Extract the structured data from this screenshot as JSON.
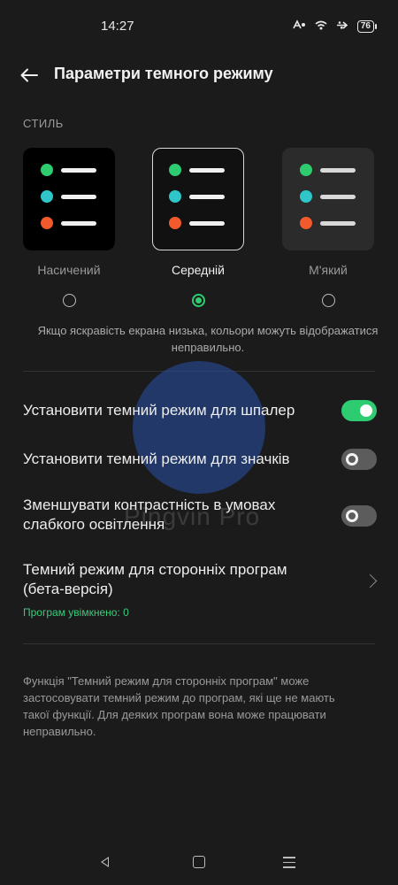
{
  "status_bar": {
    "time": "14:27",
    "battery": "76",
    "icons": [
      "nfc-icon",
      "wifi-icon",
      "usb-icon",
      "battery-icon"
    ]
  },
  "header": {
    "title": "Параметри темного режиму"
  },
  "style_section": {
    "title": "СТИЛЬ",
    "options": [
      {
        "label": "Насичений",
        "selected": false
      },
      {
        "label": "Середній",
        "selected": true
      },
      {
        "label": "М'який",
        "selected": false
      }
    ],
    "hint": "Якщо яскравість екрана низька, кольори можуть відображатися неправильно."
  },
  "settings": [
    {
      "label": "Установити темний режим для шпалер",
      "enabled": true
    },
    {
      "label": "Установити темний режим для значків",
      "enabled": false
    },
    {
      "label": "Зменшувати контрастність в умовах слабкого освітлення",
      "enabled": false
    }
  ],
  "third_party": {
    "label": "Темний режим для сторонніх програм (бета-версія)",
    "status": "Програм увімкнено: 0"
  },
  "footnote": "Функція \"Темний режим для сторонніх програм\" може застосовувати темний режим до програм, які ще не мають такої функції. Для деяких програм вона може працювати неправильно.",
  "watermark": {
    "text": "Pingvin Pro"
  },
  "colors": {
    "accent": "#2ecc71",
    "background": "#1b1b1b",
    "secondary_text": "#9a9a9a"
  }
}
